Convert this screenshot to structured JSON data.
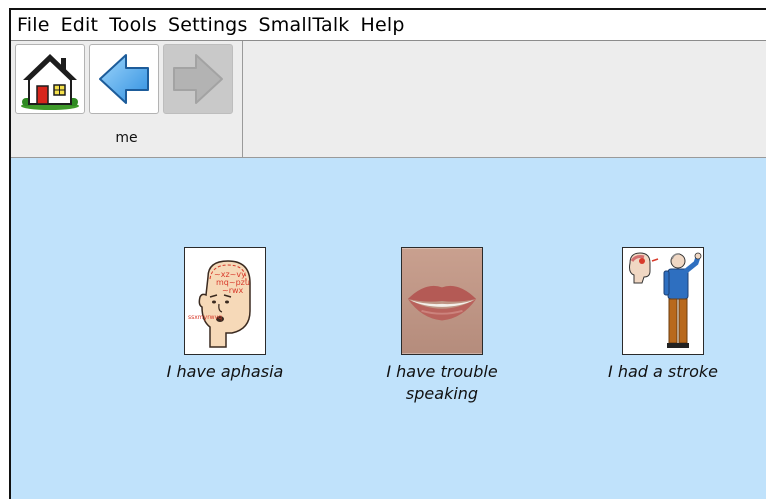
{
  "menubar": {
    "items": [
      "File",
      "Edit",
      "Tools",
      "Settings",
      "SmallTalk",
      "Help"
    ]
  },
  "toolbar": {
    "home_icon": "house-icon",
    "back_icon": "back-arrow-icon",
    "forward_icon": "forward-arrow-icon",
    "forward_enabled": false,
    "board_label": "me"
  },
  "board": {
    "background": "#c0e2fb",
    "cells": [
      {
        "label": "I have aphasia",
        "icon": "aphasia-head-icon"
      },
      {
        "label": "I have trouble speaking",
        "icon": "mouth-icon"
      },
      {
        "label": "I had a stroke",
        "icon": "stroke-person-icon"
      }
    ]
  }
}
